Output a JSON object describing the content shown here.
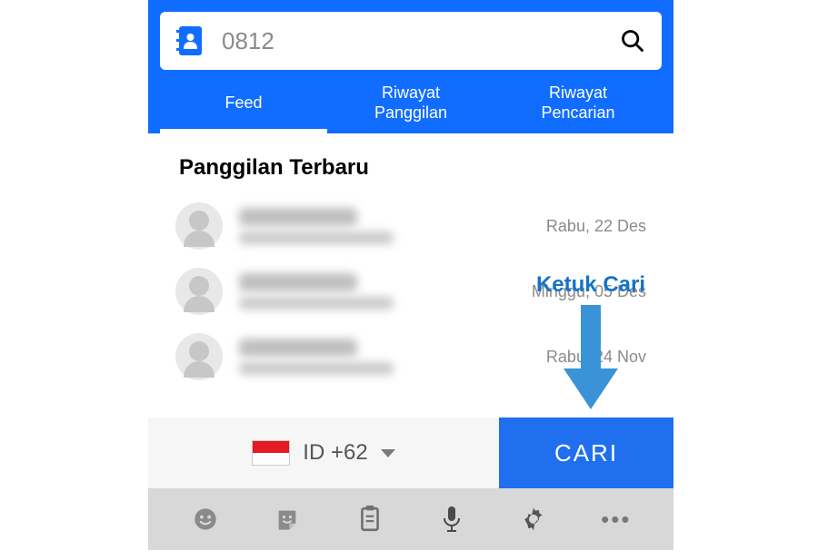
{
  "search": {
    "value": "0812"
  },
  "tabs": {
    "feed": "Feed",
    "riwayat_panggilan": "Riwayat\nPanggilan",
    "riwayat_pencarian": "Riwayat\nPencarian"
  },
  "section_title": "Panggilan Terbaru",
  "calls": [
    {
      "date": "Rabu, 22 Des"
    },
    {
      "date": "Minggu, 05 Des"
    },
    {
      "date": "Rabu, 24 Nov"
    }
  ],
  "country": {
    "code": "ID",
    "dial": "+62",
    "label": "ID  +62"
  },
  "cari_button": "CARI",
  "annotation": "Ketuk Cari"
}
